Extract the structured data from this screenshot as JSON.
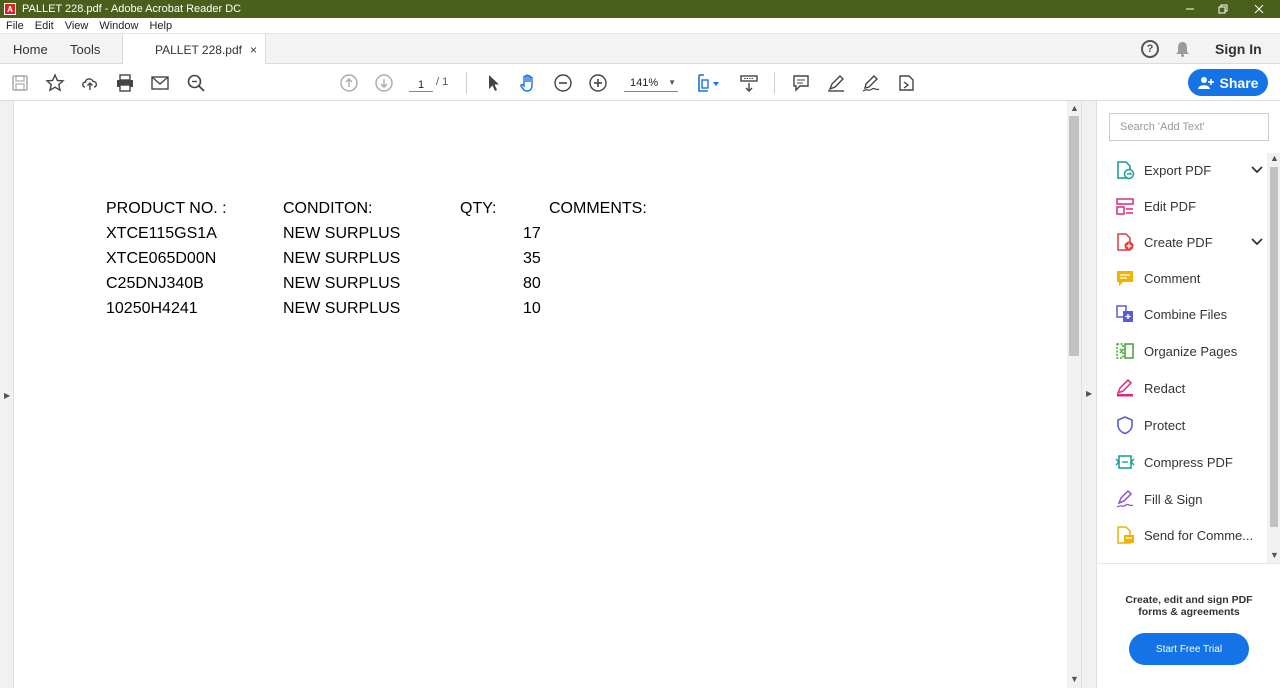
{
  "window": {
    "title": "PALLET 228.pdf - Adobe Acrobat Reader DC",
    "controls": [
      "minimize",
      "restore",
      "close"
    ]
  },
  "menu": [
    "File",
    "Edit",
    "View",
    "Window",
    "Help"
  ],
  "tabs": {
    "home": "Home",
    "tools": "Tools",
    "document": "PALLET 228.pdf",
    "close": "×",
    "sign_in": "Sign In",
    "help": "?"
  },
  "toolbar": {
    "page_current": "1",
    "page_total": "/ 1",
    "zoom": "141%",
    "share": "Share"
  },
  "document": {
    "headers": [
      "PRODUCT NO. :",
      "CONDITON:",
      "QTY:",
      "COMMENTS:"
    ],
    "rows": [
      {
        "product": "XTCE115GS1A",
        "condition": "NEW SURPLUS",
        "qty": "17"
      },
      {
        "product": "XTCE065D00N",
        "condition": "NEW SURPLUS",
        "qty": "35"
      },
      {
        "product": "C25DNJ340B",
        "condition": "NEW SURPLUS",
        "qty": "80"
      },
      {
        "product": "10250H4241",
        "condition": "NEW SURPLUS",
        "qty": "10"
      }
    ]
  },
  "right_panel": {
    "search_placeholder": "Search 'Add Text'",
    "tools": [
      {
        "label": "Export PDF",
        "icon": "export-pdf-icon",
        "color": "#0f9d8f",
        "expandable": true
      },
      {
        "label": "Edit PDF",
        "icon": "edit-pdf-icon",
        "color": "#e0297b",
        "expandable": false
      },
      {
        "label": "Create PDF",
        "icon": "create-pdf-icon",
        "color": "#e03c3c",
        "expandable": true
      },
      {
        "label": "Comment",
        "icon": "comment-icon",
        "color": "#f0b400",
        "expandable": false
      },
      {
        "label": "Combine Files",
        "icon": "combine-files-icon",
        "color": "#5b5bd6",
        "expandable": false
      },
      {
        "label": "Organize Pages",
        "icon": "organize-pages-icon",
        "color": "#3aa335",
        "expandable": false
      },
      {
        "label": "Redact",
        "icon": "redact-icon",
        "color": "#e0297b",
        "expandable": false
      },
      {
        "label": "Protect",
        "icon": "protect-icon",
        "color": "#5b5bd6",
        "expandable": false
      },
      {
        "label": "Compress PDF",
        "icon": "compress-pdf-icon",
        "color": "#0f9d8f",
        "expandable": false
      },
      {
        "label": "Fill & Sign",
        "icon": "fill-sign-icon",
        "color": "#8a52d6",
        "expandable": false
      },
      {
        "label": "Send for Comme...",
        "icon": "send-for-comment-icon",
        "color": "#f0b400",
        "expandable": false
      }
    ],
    "promo_text": "Create, edit and sign PDF forms & agreements",
    "promo_button": "Start Free Trial"
  },
  "colors": {
    "titlebar": "#4a5f1c",
    "accent": "#1473e6"
  }
}
